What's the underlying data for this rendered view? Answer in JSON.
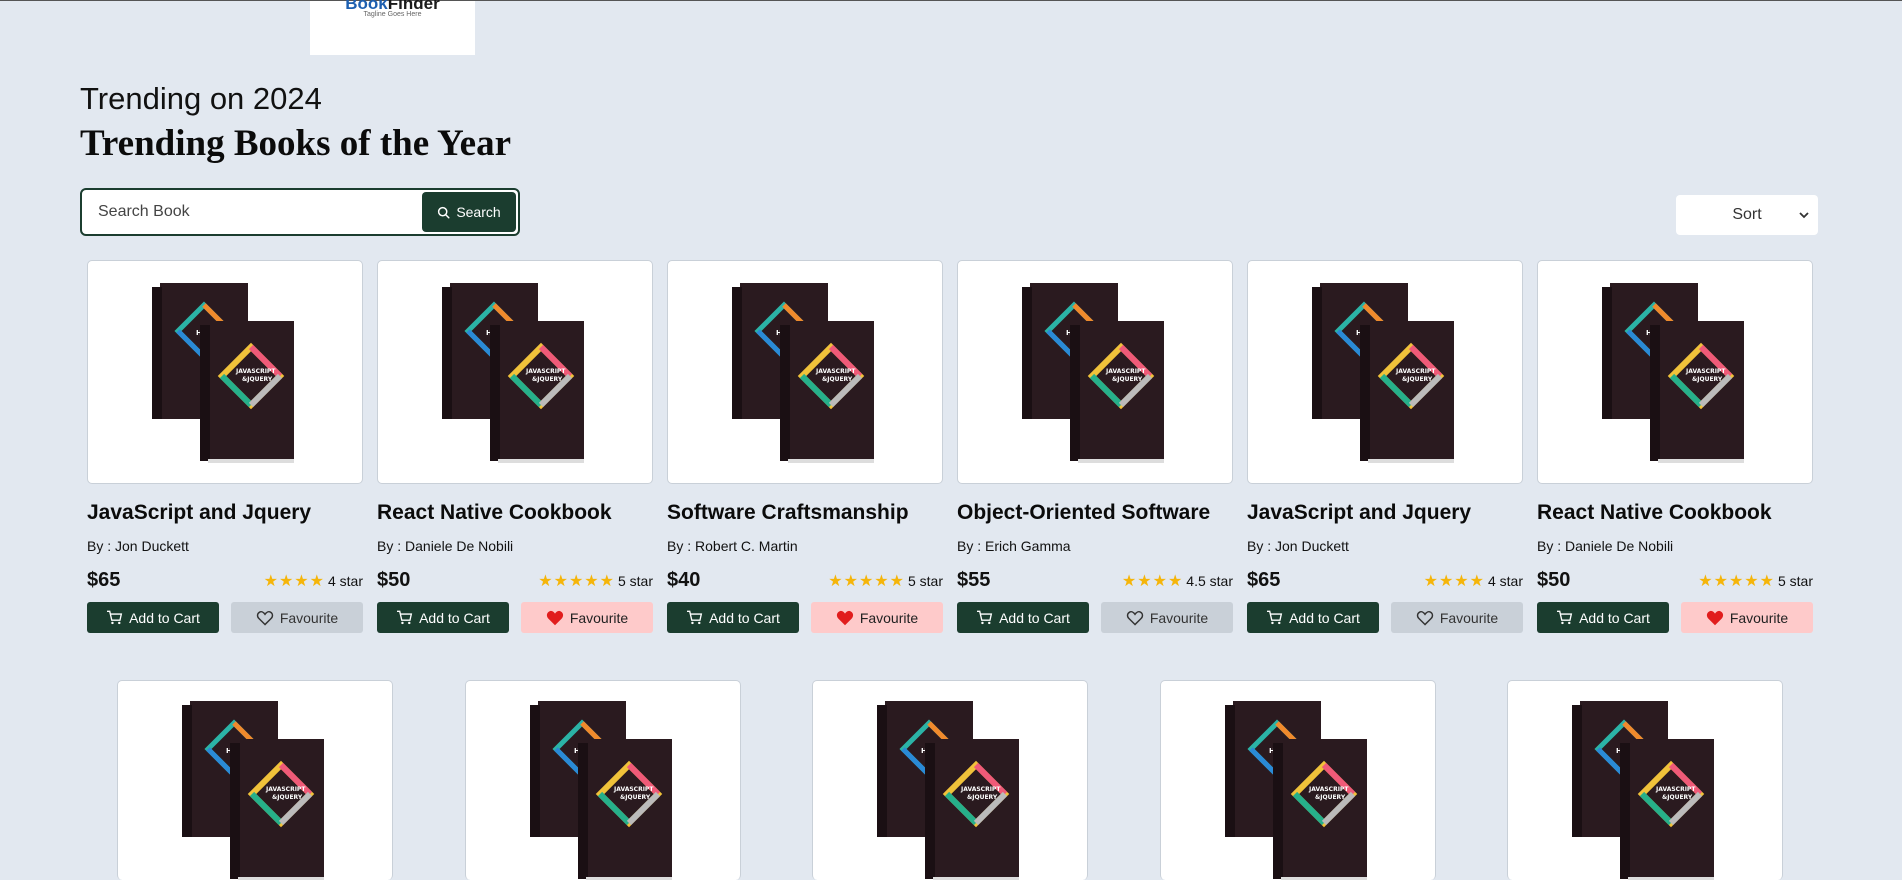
{
  "logo": {
    "brand_part1": "Book",
    "brand_part2": "Finder",
    "tagline": "Tagline Goes Here"
  },
  "header": {
    "subtitle": "Trending on 2024",
    "title": "Trending Books of the Year"
  },
  "search": {
    "placeholder": "Search Book",
    "button_label": "Search"
  },
  "sort": {
    "label": "Sort"
  },
  "colors": {
    "primary": "#1b3d2f",
    "background": "#e2e8f0",
    "star": "#f5b50a",
    "fav_active_bg": "#fecaca",
    "fav_active_icon": "#e11d1d",
    "fav_inactive_bg": "#c9d0d8"
  },
  "books": [
    {
      "title": "JavaScript and Jquery",
      "author": "By : Jon Duckett",
      "price": "$65",
      "stars": "★★★★",
      "rating": "4 star",
      "cart_label": "Add to Cart",
      "fav_label": "Favourite",
      "favourite": false
    },
    {
      "title": "React Native Cookbook",
      "author": "By : Daniele De Nobili",
      "price": "$50",
      "stars": "★★★★★",
      "rating": "5 star",
      "cart_label": "Add to Cart",
      "fav_label": "Favourite",
      "favourite": true
    },
    {
      "title": "Software Craftsmanship",
      "author": "By : Robert C. Martin",
      "price": "$40",
      "stars": "★★★★★",
      "rating": "5 star",
      "cart_label": "Add to Cart",
      "fav_label": "Favourite",
      "favourite": true
    },
    {
      "title": "Object-Oriented Software",
      "author": "By : Erich Gamma",
      "price": "$55",
      "stars": "★★★★",
      "rating": "4.5 star",
      "cart_label": "Add to Cart",
      "fav_label": "Favourite",
      "favourite": false
    },
    {
      "title": "JavaScript and Jquery",
      "author": "By : Jon Duckett",
      "price": "$65",
      "stars": "★★★★",
      "rating": "4 star",
      "cart_label": "Add to Cart",
      "fav_label": "Favourite",
      "favourite": false
    },
    {
      "title": "React Native Cookbook",
      "author": "By : Daniele De Nobili",
      "price": "$50",
      "stars": "★★★★★",
      "rating": "5 star",
      "cart_label": "Add to Cart",
      "fav_label": "Favourite",
      "favourite": true
    }
  ]
}
